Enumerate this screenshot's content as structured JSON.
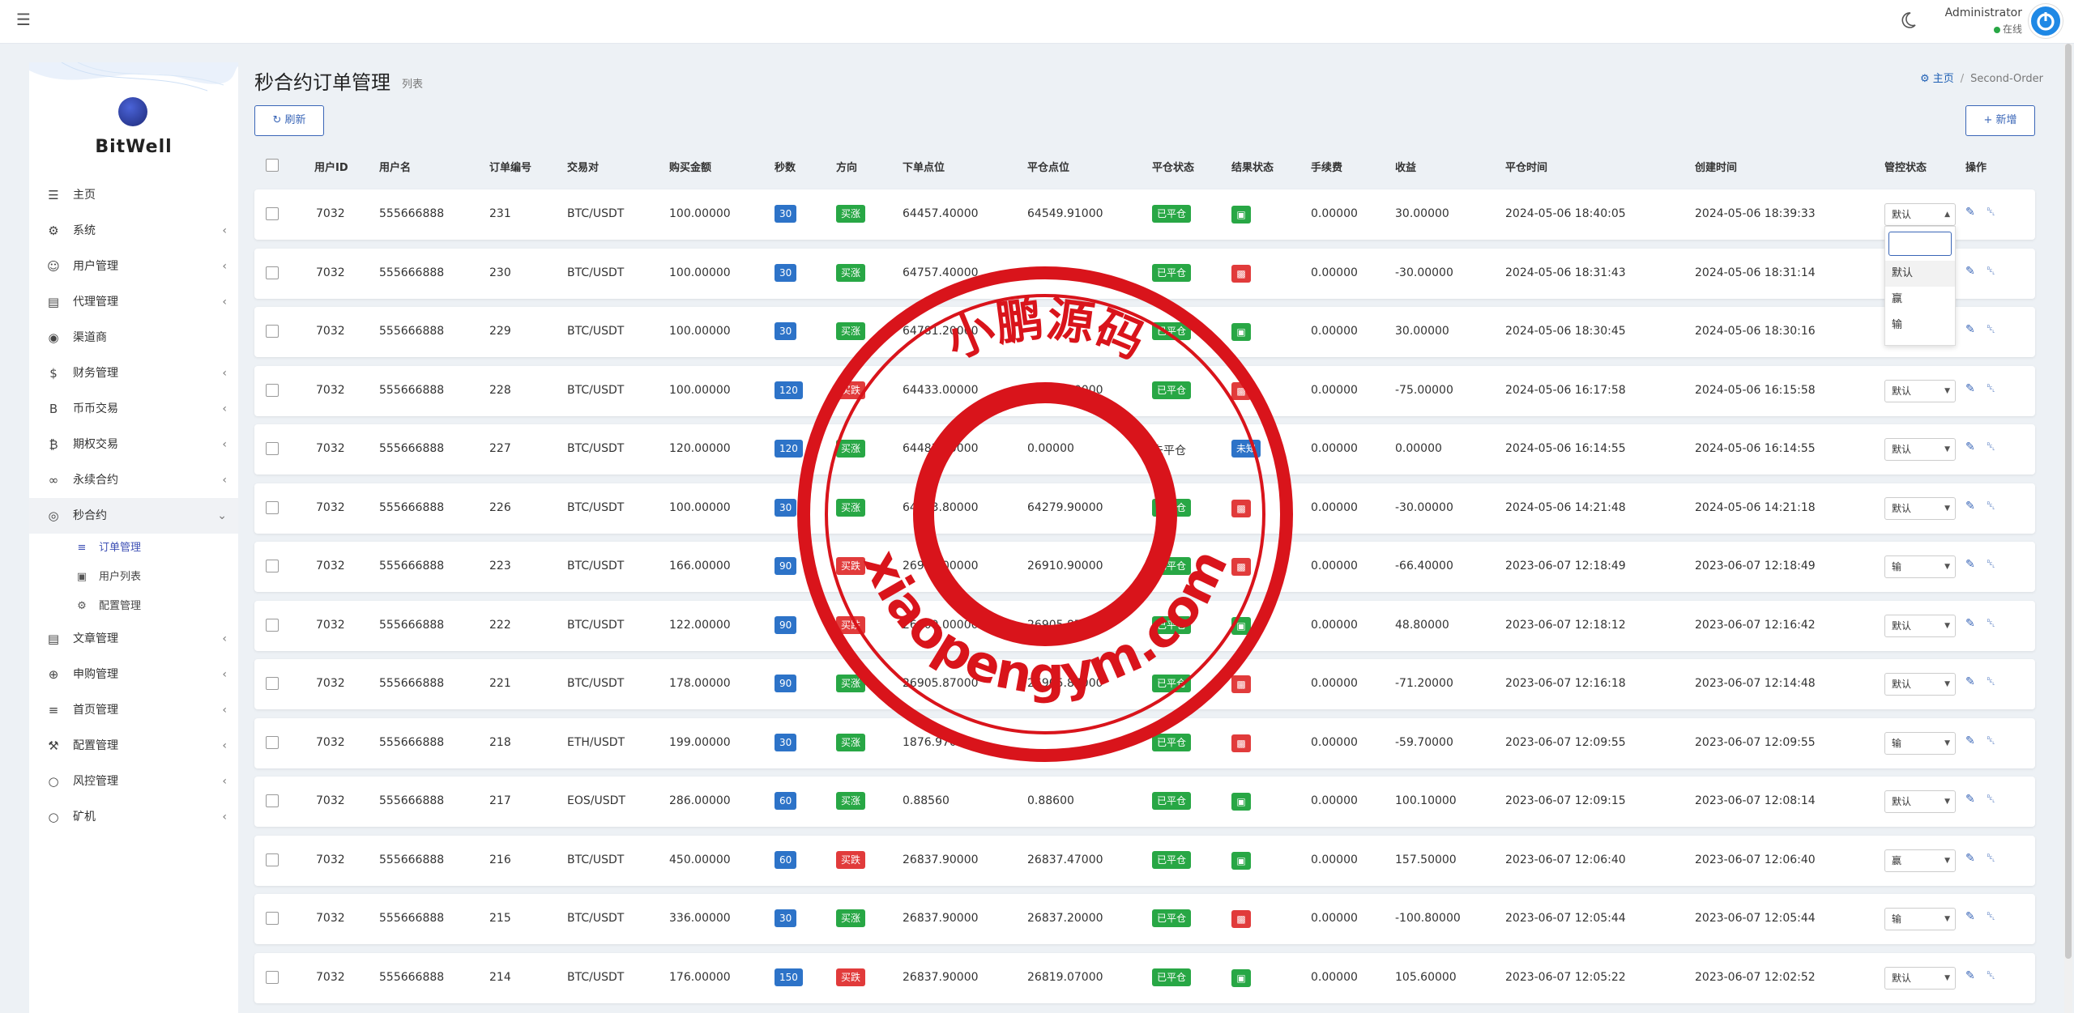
{
  "topbar": {
    "user_name": "Administrator",
    "user_status": "在线"
  },
  "sidebar": {
    "logo": "BitWell",
    "items": [
      {
        "label": "主页",
        "icon": "chart-icon",
        "glyph": "☰",
        "has_sub": false
      },
      {
        "label": "系统",
        "icon": "gear-icon",
        "glyph": "⚙",
        "has_sub": true
      },
      {
        "label": "用户管理",
        "icon": "user-icon",
        "glyph": "☺",
        "has_sub": true
      },
      {
        "label": "代理管理",
        "icon": "id-card-icon",
        "glyph": "▤",
        "has_sub": true
      },
      {
        "label": "渠道商",
        "icon": "user-circle-icon",
        "glyph": "◉",
        "has_sub": false
      },
      {
        "label": "财务管理",
        "icon": "dollar-icon",
        "glyph": "$",
        "has_sub": true
      },
      {
        "label": "币币交易",
        "icon": "bitcoin-icon",
        "glyph": "B",
        "has_sub": true
      },
      {
        "label": "期权交易",
        "icon": "bitcoin-icon",
        "glyph": "₿",
        "has_sub": true
      },
      {
        "label": "永续合约",
        "icon": "link-icon",
        "glyph": "∞",
        "has_sub": true
      },
      {
        "label": "秒合约",
        "icon": "circle-dot-icon",
        "glyph": "◎",
        "has_sub": true,
        "expanded": true
      }
    ],
    "sub_items": [
      {
        "label": "订单管理",
        "icon": "list-icon",
        "glyph": "≡",
        "active": true
      },
      {
        "label": "用户列表",
        "icon": "portrait-icon",
        "glyph": "▣",
        "active": false
      },
      {
        "label": "配置管理",
        "icon": "gear-icon",
        "glyph": "⚙",
        "active": false
      }
    ],
    "items_after": [
      {
        "label": "文章管理",
        "icon": "news-icon",
        "glyph": "▤"
      },
      {
        "label": "申购管理",
        "icon": "globe-icon",
        "glyph": "⊕"
      },
      {
        "label": "首页管理",
        "icon": "list-icon",
        "glyph": "≡"
      },
      {
        "label": "配置管理",
        "icon": "wrench-icon",
        "glyph": "⚒"
      },
      {
        "label": "风控管理",
        "icon": "circle-icon",
        "glyph": "○"
      },
      {
        "label": "矿机",
        "icon": "circle-icon",
        "glyph": "○"
      }
    ]
  },
  "header": {
    "title": "秒合约订单管理",
    "subtitle": "列表",
    "breadcrumb_home": "主页",
    "breadcrumb_current": "Second-Order",
    "refresh_label": "刷新",
    "add_label": "新增"
  },
  "table": {
    "columns": [
      "用户ID",
      "用户名",
      "订单编号",
      "交易对",
      "购买金额",
      "秒数",
      "方向",
      "下单点位",
      "平仓点位",
      "平仓状态",
      "结果状态",
      "手续费",
      "收益",
      "平仓时间",
      "创建时间",
      "管控状态",
      "操作"
    ],
    "rows": [
      {
        "uid": "7032",
        "uname": "555666888",
        "order": "231",
        "pair": "BTC/USDT",
        "amount": "100.00000",
        "secs": "30",
        "dir": "买涨",
        "open": "64457.40000",
        "close": "64549.91000",
        "close_status": "已平仓",
        "result": "win",
        "fee": "0.00000",
        "profit": "30.00000",
        "close_time": "2024-05-06 18:40:05",
        "create_time": "2024-05-06 18:39:33",
        "control": "默认"
      },
      {
        "uid": "7032",
        "uname": "555666888",
        "order": "230",
        "pair": "BTC/USDT",
        "amount": "100.00000",
        "secs": "30",
        "dir": "买涨",
        "open": "64757.40000",
        "close": "",
        "close_status": "已平仓",
        "result": "lose",
        "fee": "0.00000",
        "profit": "-30.00000",
        "close_time": "2024-05-06 18:31:43",
        "create_time": "2024-05-06 18:31:14",
        "control": ""
      },
      {
        "uid": "7032",
        "uname": "555666888",
        "order": "229",
        "pair": "BTC/USDT",
        "amount": "100.00000",
        "secs": "30",
        "dir": "买涨",
        "open": "64781.20000",
        "close": "",
        "close_status": "已平仓",
        "result": "win",
        "fee": "0.00000",
        "profit": "30.00000",
        "close_time": "2024-05-06 18:30:45",
        "create_time": "2024-05-06 18:30:16",
        "control": ""
      },
      {
        "uid": "7032",
        "uname": "555666888",
        "order": "228",
        "pair": "BTC/USDT",
        "amount": "100.00000",
        "secs": "120",
        "dir": "买跌",
        "open": "64433.00000",
        "close": "64500.70000",
        "close_status": "已平仓",
        "result": "lose",
        "fee": "0.00000",
        "profit": "-75.00000",
        "close_time": "2024-05-06 16:17:58",
        "create_time": "2024-05-06 16:15:58",
        "control": "默认"
      },
      {
        "uid": "7032",
        "uname": "555666888",
        "order": "227",
        "pair": "BTC/USDT",
        "amount": "120.00000",
        "secs": "120",
        "dir": "买涨",
        "open": "64483.20000",
        "close": "0.00000",
        "close_status": "未平仓",
        "result": "unknown",
        "fee": "0.00000",
        "profit": "0.00000",
        "close_time": "2024-05-06 16:14:55",
        "create_time": "2024-05-06 16:14:55",
        "control": "默认"
      },
      {
        "uid": "7032",
        "uname": "555666888",
        "order": "226",
        "pair": "BTC/USDT",
        "amount": "100.00000",
        "secs": "30",
        "dir": "买涨",
        "open": "64303.80000",
        "close": "64279.90000",
        "close_status": "已平仓",
        "result": "lose",
        "fee": "0.00000",
        "profit": "-30.00000",
        "close_time": "2024-05-06 14:21:48",
        "create_time": "2024-05-06 14:21:18",
        "control": "默认"
      },
      {
        "uid": "7032",
        "uname": "555666888",
        "order": "223",
        "pair": "BTC/USDT",
        "amount": "166.00000",
        "secs": "90",
        "dir": "买跌",
        "open": "26909.00000",
        "close": "26910.90000",
        "close_status": "已平仓",
        "result": "lose",
        "fee": "0.00000",
        "profit": "-66.40000",
        "close_time": "2023-06-07 12:18:49",
        "create_time": "2023-06-07 12:18:49",
        "control": "输"
      },
      {
        "uid": "7032",
        "uname": "555666888",
        "order": "222",
        "pair": "BTC/USDT",
        "amount": "122.00000",
        "secs": "90",
        "dir": "买跌",
        "open": "26909.00000",
        "close": "26905.87000",
        "close_status": "已平仓",
        "result": "win",
        "fee": "0.00000",
        "profit": "48.80000",
        "close_time": "2023-06-07 12:18:12",
        "create_time": "2023-06-07 12:16:42",
        "control": "默认"
      },
      {
        "uid": "7032",
        "uname": "555666888",
        "order": "221",
        "pair": "BTC/USDT",
        "amount": "178.00000",
        "secs": "90",
        "dir": "买涨",
        "open": "26905.87000",
        "close": "26905.87000",
        "close_status": "已平仓",
        "result": "lose",
        "fee": "0.00000",
        "profit": "-71.20000",
        "close_time": "2023-06-07 12:16:18",
        "create_time": "2023-06-07 12:14:48",
        "control": "默认"
      },
      {
        "uid": "7032",
        "uname": "555666888",
        "order": "218",
        "pair": "ETH/USDT",
        "amount": "199.00000",
        "secs": "30",
        "dir": "买涨",
        "open": "1876.97000",
        "close": "",
        "close_status": "已平仓",
        "result": "lose",
        "fee": "0.00000",
        "profit": "-59.70000",
        "close_time": "2023-06-07 12:09:55",
        "create_time": "2023-06-07 12:09:55",
        "control": "输"
      },
      {
        "uid": "7032",
        "uname": "555666888",
        "order": "217",
        "pair": "EOS/USDT",
        "amount": "286.00000",
        "secs": "60",
        "dir": "买涨",
        "open": "0.88560",
        "close": "0.88600",
        "close_status": "已平仓",
        "result": "win",
        "fee": "0.00000",
        "profit": "100.10000",
        "close_time": "2023-06-07 12:09:15",
        "create_time": "2023-06-07 12:08:14",
        "control": "默认"
      },
      {
        "uid": "7032",
        "uname": "555666888",
        "order": "216",
        "pair": "BTC/USDT",
        "amount": "450.00000",
        "secs": "60",
        "dir": "买跌",
        "open": "26837.90000",
        "close": "26837.47000",
        "close_status": "已平仓",
        "result": "win",
        "fee": "0.00000",
        "profit": "157.50000",
        "close_time": "2023-06-07 12:06:40",
        "create_time": "2023-06-07 12:06:40",
        "control": "赢"
      },
      {
        "uid": "7032",
        "uname": "555666888",
        "order": "215",
        "pair": "BTC/USDT",
        "amount": "336.00000",
        "secs": "30",
        "dir": "买涨",
        "open": "26837.90000",
        "close": "26837.20000",
        "close_status": "已平仓",
        "result": "lose",
        "fee": "0.00000",
        "profit": "-100.80000",
        "close_time": "2023-06-07 12:05:44",
        "create_time": "2023-06-07 12:05:44",
        "control": "输"
      },
      {
        "uid": "7032",
        "uname": "555666888",
        "order": "214",
        "pair": "BTC/USDT",
        "amount": "176.00000",
        "secs": "150",
        "dir": "买跌",
        "open": "26837.90000",
        "close": "26819.07000",
        "close_status": "已平仓",
        "result": "win",
        "fee": "0.00000",
        "profit": "105.60000",
        "close_time": "2023-06-07 12:05:22",
        "create_time": "2023-06-07 12:02:52",
        "control": "默认"
      }
    ],
    "result_labels": {
      "unknown": "未知"
    }
  },
  "dropdown": {
    "options": [
      "默认",
      "赢",
      "输"
    ],
    "highlighted": "默认"
  },
  "stamp": {
    "top_text": "小鹏源码",
    "bottom_text": "xiaopengym.com",
    "color": "#d9141b"
  },
  "colors": {
    "accent": "#3a66b7",
    "win": "#28a745",
    "lose": "#e13b3b",
    "secs_badge": "#2d73c8"
  }
}
